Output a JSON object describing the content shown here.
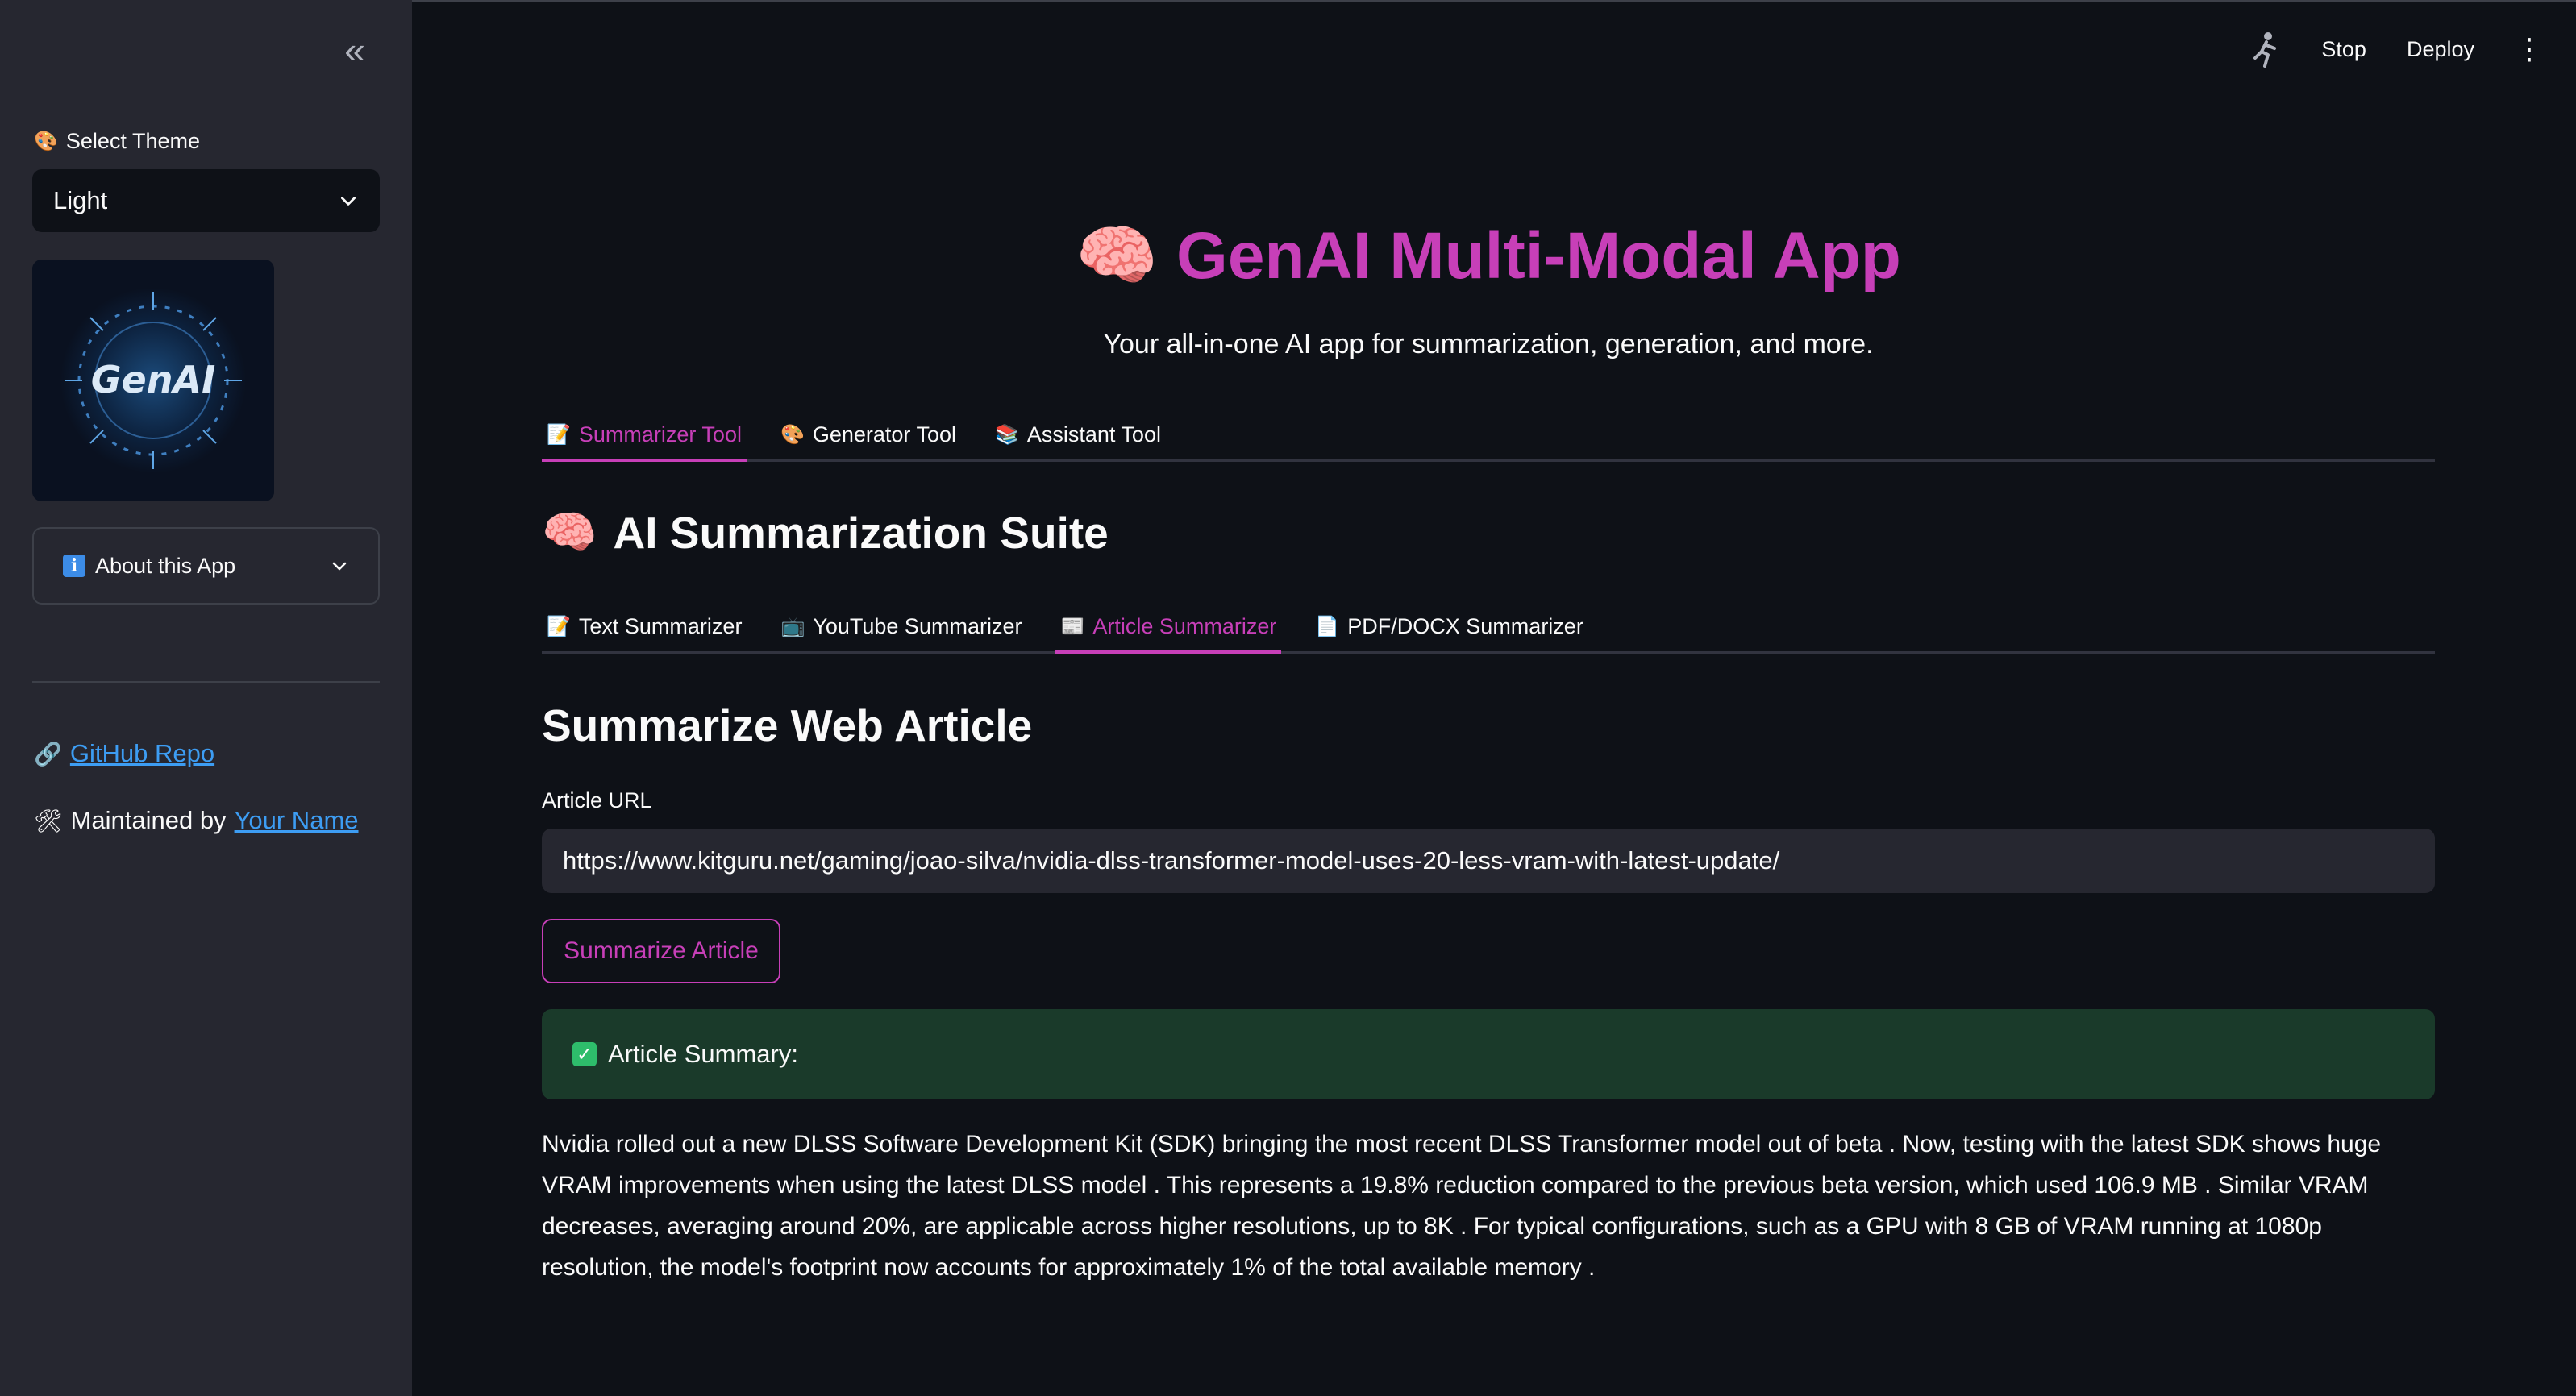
{
  "sidebar": {
    "collapse_icon": "«",
    "theme_label": "Select Theme",
    "theme_value": "Light",
    "logo_text": "GenAI",
    "about_label": "About this App",
    "github_link": "GitHub Repo",
    "maintained_prefix": "Maintained by",
    "maintainer_link": "Your Name"
  },
  "header": {
    "stop_label": "Stop",
    "deploy_label": "Deploy"
  },
  "main": {
    "title": "GenAI Multi-Modal App",
    "subtitle": "Your all-in-one AI app for summarization, generation, and more.",
    "outer_tabs": [
      {
        "label": "Summarizer Tool"
      },
      {
        "label": "Generator Tool"
      },
      {
        "label": "Assistant Tool"
      }
    ],
    "section_title": "AI Summarization Suite",
    "inner_tabs": [
      {
        "label": "Text Summarizer"
      },
      {
        "label": "YouTube Summarizer"
      },
      {
        "label": "Article Summarizer"
      },
      {
        "label": "PDF/DOCX Summarizer"
      }
    ],
    "subheader": "Summarize Web Article",
    "url_label": "Article URL",
    "url_value": "https://www.kitguru.net/gaming/joao-silva/nvidia-dlss-transformer-model-uses-20-less-vram-with-latest-update/",
    "button_label": "Summarize Article",
    "success_label": "Article Summary:",
    "summary": "Nvidia rolled out a new DLSS Software Development Kit (SDK) bringing the most recent DLSS Transformer model out of beta . Now, testing with the latest SDK shows huge VRAM improvements when using the latest DLSS model . This represents a 19.8% reduction compared to the previous beta version, which used 106.9 MB . Similar VRAM decreases, averaging around 20%, are applicable across higher resolutions, up to 8K . For typical configurations, such as a GPU with 8 GB of VRAM running at 1080p resolution, the model's footprint now accounts for approximately 1% of the total available memory ."
  },
  "colors": {
    "accent": "#c73fb8",
    "background": "#0e1117",
    "sidebar": "#262730",
    "success_bg": "#1a3a2a",
    "link": "#3d9df3"
  }
}
